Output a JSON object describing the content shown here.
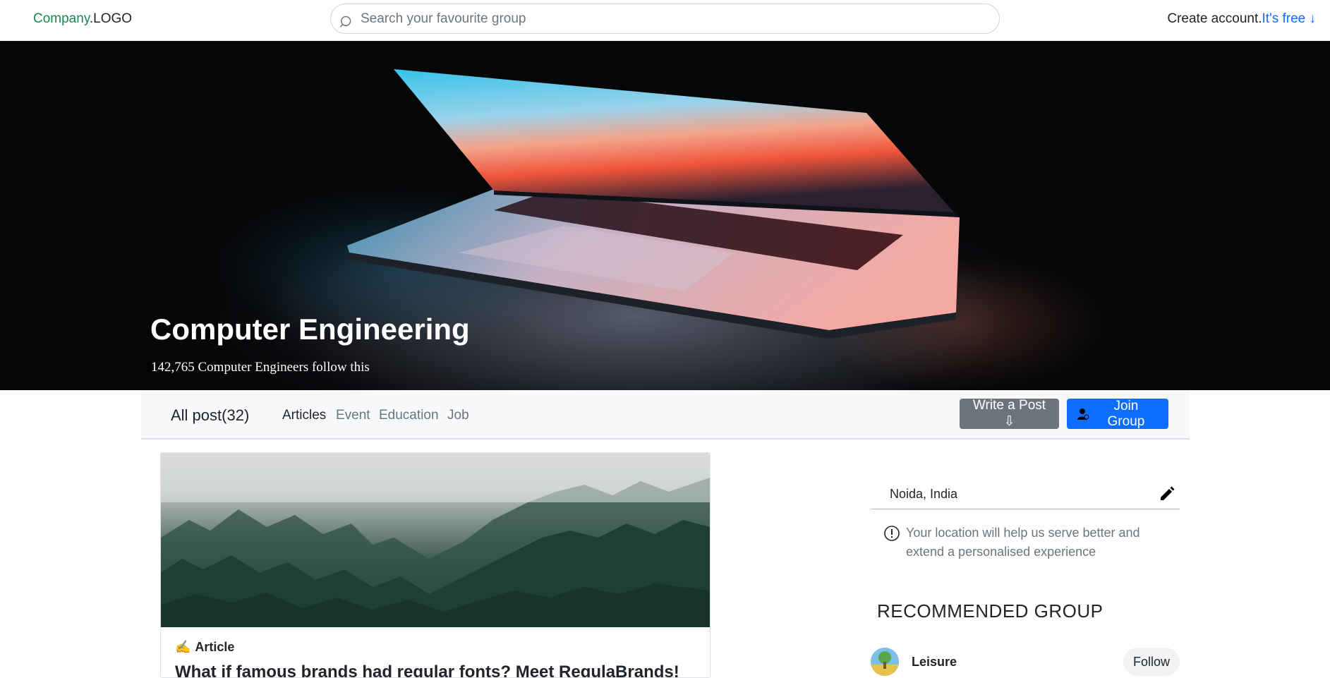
{
  "header": {
    "logo_brand": "Company",
    "logo_suffix": ".LOGO",
    "search_placeholder": "Search your favourite group",
    "create_text": "Create account.",
    "create_link": "It's free ↓"
  },
  "hero": {
    "title": "Computer Engineering",
    "subtitle": "142,765 Computer Engineers follow this"
  },
  "tabs": {
    "all_post": "All post(32)",
    "items": [
      "Articles",
      "Event",
      "Education",
      "Job"
    ],
    "active": "Articles",
    "write_post": "Write a Post ⇩",
    "join_group": "Join Group"
  },
  "post": {
    "tag": "Article",
    "title": "What if famous brands had regular fonts? Meet RegulaBrands!"
  },
  "sidebar": {
    "location": "Noida, India",
    "location_info": "Your location will help us serve better and extend a personalised experience",
    "recommended_title": "RECOMMENDED GROUP",
    "groups": [
      {
        "name": "Leisure",
        "action": "Follow"
      }
    ]
  },
  "icons": {
    "search": "search-icon",
    "edit": "pencil-icon",
    "info": "info-circle-icon",
    "user": "user-plus-icon",
    "article": "writing-hand-icon"
  },
  "colors": {
    "brand": "#198754",
    "link": "#0d6efd",
    "grey_button": "#6c757d",
    "blue_button": "#0d6efd"
  }
}
